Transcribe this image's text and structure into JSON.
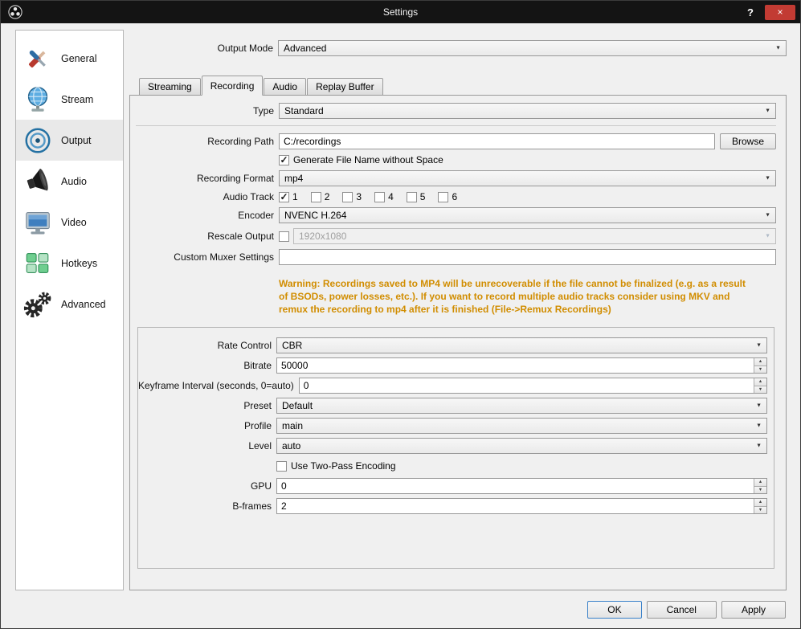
{
  "window": {
    "title": "Settings",
    "help": "?",
    "close": "×"
  },
  "sidebar": {
    "items": [
      {
        "label": "General"
      },
      {
        "label": "Stream"
      },
      {
        "label": "Output"
      },
      {
        "label": "Audio"
      },
      {
        "label": "Video"
      },
      {
        "label": "Hotkeys"
      },
      {
        "label": "Advanced"
      }
    ]
  },
  "header": {
    "output_mode_label": "Output Mode",
    "output_mode_value": "Advanced"
  },
  "tabs": {
    "streaming": "Streaming",
    "recording": "Recording",
    "audio": "Audio",
    "replay_buffer": "Replay Buffer"
  },
  "recording": {
    "type_label": "Type",
    "type_value": "Standard",
    "path_label": "Recording Path",
    "path_value": "C:/recordings",
    "browse_label": "Browse",
    "generate_label": "Generate File Name without Space",
    "format_label": "Recording Format",
    "format_value": "mp4",
    "audio_track_label": "Audio Track",
    "audio_tracks": [
      "1",
      "2",
      "3",
      "4",
      "5",
      "6"
    ],
    "encoder_label": "Encoder",
    "encoder_value": "NVENC H.264",
    "rescale_label": "Rescale Output",
    "rescale_value": "1920x1080",
    "muxer_label": "Custom Muxer Settings",
    "muxer_value": "",
    "warning": "Warning: Recordings saved to MP4 will be unrecoverable if the file cannot be finalized (e.g. as a result of BSODs, power losses, etc.). If you want to record multiple audio tracks consider using MKV and remux the recording to mp4 after it is finished (File->Remux Recordings)"
  },
  "encoder": {
    "rate_control_label": "Rate Control",
    "rate_control_value": "CBR",
    "bitrate_label": "Bitrate",
    "bitrate_value": "50000",
    "keyframe_label": "Keyframe Interval (seconds, 0=auto)",
    "keyframe_value": "0",
    "preset_label": "Preset",
    "preset_value": "Default",
    "profile_label": "Profile",
    "profile_value": "main",
    "level_label": "Level",
    "level_value": "auto",
    "two_pass_label": "Use Two-Pass Encoding",
    "gpu_label": "GPU",
    "gpu_value": "0",
    "bframes_label": "B-frames",
    "bframes_value": "2"
  },
  "footer": {
    "ok": "OK",
    "cancel": "Cancel",
    "apply": "Apply"
  },
  "colors": {
    "warning": "#d18d00",
    "accent": "#3a81c9",
    "close": "#c23b33"
  }
}
